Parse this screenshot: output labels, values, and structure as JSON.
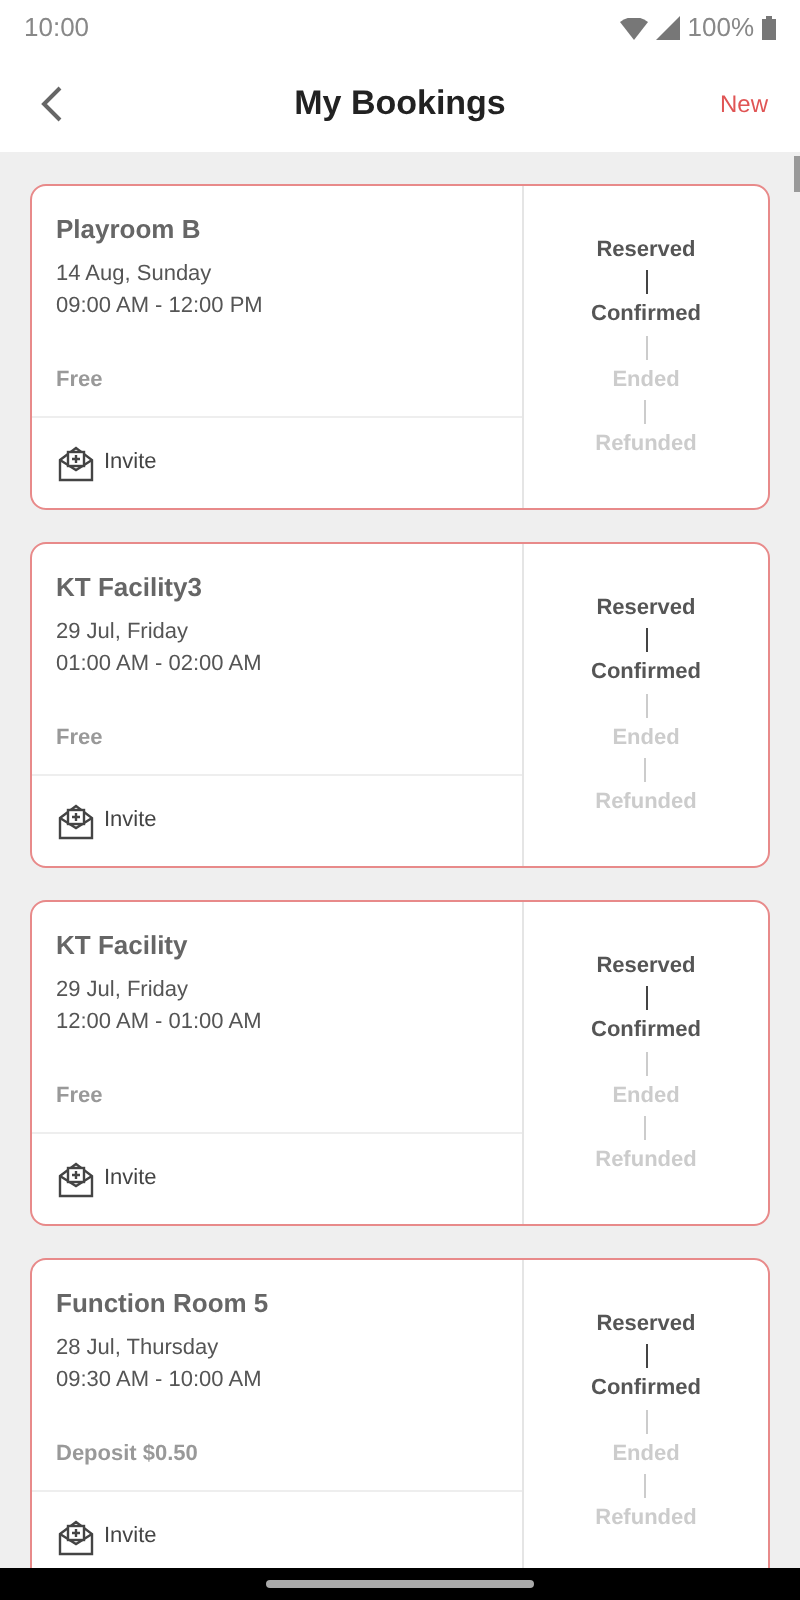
{
  "status_bar": {
    "time": "10:00",
    "battery": "100%"
  },
  "header": {
    "title": "My Bookings",
    "action": "New"
  },
  "bookings": [
    {
      "title": "Playroom B",
      "date": "14 Aug, Sunday",
      "time": "09:00 AM - 12:00 PM",
      "price": "Free",
      "invite": "Invite",
      "steps": [
        {
          "label": "Reserved",
          "done": true
        },
        {
          "label": "Confirmed",
          "done": true
        },
        {
          "label": "Ended",
          "done": false
        },
        {
          "label": "Refunded",
          "done": false
        }
      ]
    },
    {
      "title": "KT Facility3",
      "date": "29 Jul, Friday",
      "time": "01:00 AM - 02:00 AM",
      "price": "Free",
      "invite": "Invite",
      "steps": [
        {
          "label": "Reserved",
          "done": true
        },
        {
          "label": "Confirmed",
          "done": true
        },
        {
          "label": "Ended",
          "done": false
        },
        {
          "label": "Refunded",
          "done": false
        }
      ]
    },
    {
      "title": "KT Facility",
      "date": "29 Jul, Friday",
      "time": "12:00 AM - 01:00 AM",
      "price": "Free",
      "invite": "Invite",
      "steps": [
        {
          "label": "Reserved",
          "done": true
        },
        {
          "label": "Confirmed",
          "done": true
        },
        {
          "label": "Ended",
          "done": false
        },
        {
          "label": "Refunded",
          "done": false
        }
      ]
    },
    {
      "title": "Function Room 5",
      "date": "28 Jul, Thursday",
      "time": "09:30 AM - 10:00 AM",
      "price": "Deposit $0.50",
      "invite": "Invite",
      "steps": [
        {
          "label": "Reserved",
          "done": true
        },
        {
          "label": "Confirmed",
          "done": true
        },
        {
          "label": "Ended",
          "done": false
        },
        {
          "label": "Refunded",
          "done": false
        }
      ]
    }
  ]
}
